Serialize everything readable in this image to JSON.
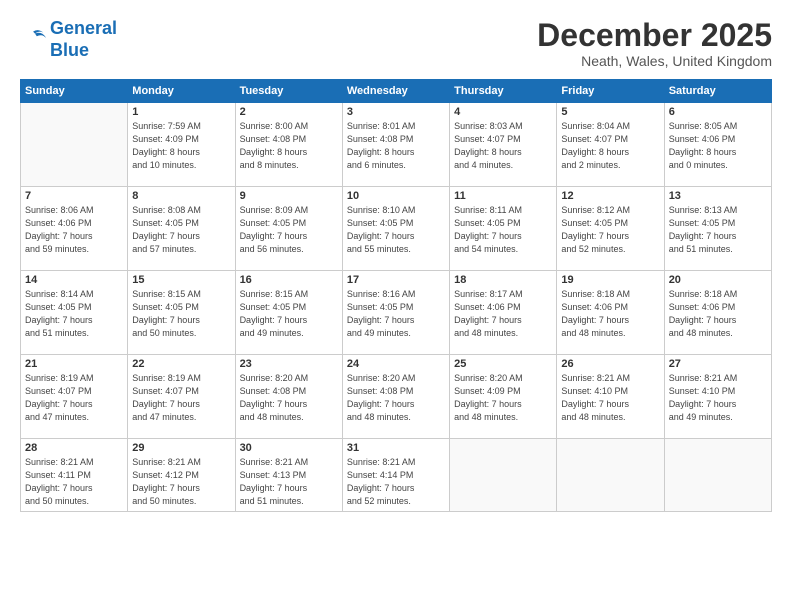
{
  "header": {
    "logo_line1": "General",
    "logo_line2": "Blue",
    "month_title": "December 2025",
    "location": "Neath, Wales, United Kingdom"
  },
  "weekdays": [
    "Sunday",
    "Monday",
    "Tuesday",
    "Wednesday",
    "Thursday",
    "Friday",
    "Saturday"
  ],
  "weeks": [
    [
      {
        "day": "",
        "info": ""
      },
      {
        "day": "1",
        "info": "Sunrise: 7:59 AM\nSunset: 4:09 PM\nDaylight: 8 hours\nand 10 minutes."
      },
      {
        "day": "2",
        "info": "Sunrise: 8:00 AM\nSunset: 4:08 PM\nDaylight: 8 hours\nand 8 minutes."
      },
      {
        "day": "3",
        "info": "Sunrise: 8:01 AM\nSunset: 4:08 PM\nDaylight: 8 hours\nand 6 minutes."
      },
      {
        "day": "4",
        "info": "Sunrise: 8:03 AM\nSunset: 4:07 PM\nDaylight: 8 hours\nand 4 minutes."
      },
      {
        "day": "5",
        "info": "Sunrise: 8:04 AM\nSunset: 4:07 PM\nDaylight: 8 hours\nand 2 minutes."
      },
      {
        "day": "6",
        "info": "Sunrise: 8:05 AM\nSunset: 4:06 PM\nDaylight: 8 hours\nand 0 minutes."
      }
    ],
    [
      {
        "day": "7",
        "info": "Sunrise: 8:06 AM\nSunset: 4:06 PM\nDaylight: 7 hours\nand 59 minutes."
      },
      {
        "day": "8",
        "info": "Sunrise: 8:08 AM\nSunset: 4:05 PM\nDaylight: 7 hours\nand 57 minutes."
      },
      {
        "day": "9",
        "info": "Sunrise: 8:09 AM\nSunset: 4:05 PM\nDaylight: 7 hours\nand 56 minutes."
      },
      {
        "day": "10",
        "info": "Sunrise: 8:10 AM\nSunset: 4:05 PM\nDaylight: 7 hours\nand 55 minutes."
      },
      {
        "day": "11",
        "info": "Sunrise: 8:11 AM\nSunset: 4:05 PM\nDaylight: 7 hours\nand 54 minutes."
      },
      {
        "day": "12",
        "info": "Sunrise: 8:12 AM\nSunset: 4:05 PM\nDaylight: 7 hours\nand 52 minutes."
      },
      {
        "day": "13",
        "info": "Sunrise: 8:13 AM\nSunset: 4:05 PM\nDaylight: 7 hours\nand 51 minutes."
      }
    ],
    [
      {
        "day": "14",
        "info": "Sunrise: 8:14 AM\nSunset: 4:05 PM\nDaylight: 7 hours\nand 51 minutes."
      },
      {
        "day": "15",
        "info": "Sunrise: 8:15 AM\nSunset: 4:05 PM\nDaylight: 7 hours\nand 50 minutes."
      },
      {
        "day": "16",
        "info": "Sunrise: 8:15 AM\nSunset: 4:05 PM\nDaylight: 7 hours\nand 49 minutes."
      },
      {
        "day": "17",
        "info": "Sunrise: 8:16 AM\nSunset: 4:05 PM\nDaylight: 7 hours\nand 49 minutes."
      },
      {
        "day": "18",
        "info": "Sunrise: 8:17 AM\nSunset: 4:06 PM\nDaylight: 7 hours\nand 48 minutes."
      },
      {
        "day": "19",
        "info": "Sunrise: 8:18 AM\nSunset: 4:06 PM\nDaylight: 7 hours\nand 48 minutes."
      },
      {
        "day": "20",
        "info": "Sunrise: 8:18 AM\nSunset: 4:06 PM\nDaylight: 7 hours\nand 48 minutes."
      }
    ],
    [
      {
        "day": "21",
        "info": "Sunrise: 8:19 AM\nSunset: 4:07 PM\nDaylight: 7 hours\nand 47 minutes."
      },
      {
        "day": "22",
        "info": "Sunrise: 8:19 AM\nSunset: 4:07 PM\nDaylight: 7 hours\nand 47 minutes."
      },
      {
        "day": "23",
        "info": "Sunrise: 8:20 AM\nSunset: 4:08 PM\nDaylight: 7 hours\nand 48 minutes."
      },
      {
        "day": "24",
        "info": "Sunrise: 8:20 AM\nSunset: 4:08 PM\nDaylight: 7 hours\nand 48 minutes."
      },
      {
        "day": "25",
        "info": "Sunrise: 8:20 AM\nSunset: 4:09 PM\nDaylight: 7 hours\nand 48 minutes."
      },
      {
        "day": "26",
        "info": "Sunrise: 8:21 AM\nSunset: 4:10 PM\nDaylight: 7 hours\nand 48 minutes."
      },
      {
        "day": "27",
        "info": "Sunrise: 8:21 AM\nSunset: 4:10 PM\nDaylight: 7 hours\nand 49 minutes."
      }
    ],
    [
      {
        "day": "28",
        "info": "Sunrise: 8:21 AM\nSunset: 4:11 PM\nDaylight: 7 hours\nand 50 minutes."
      },
      {
        "day": "29",
        "info": "Sunrise: 8:21 AM\nSunset: 4:12 PM\nDaylight: 7 hours\nand 50 minutes."
      },
      {
        "day": "30",
        "info": "Sunrise: 8:21 AM\nSunset: 4:13 PM\nDaylight: 7 hours\nand 51 minutes."
      },
      {
        "day": "31",
        "info": "Sunrise: 8:21 AM\nSunset: 4:14 PM\nDaylight: 7 hours\nand 52 minutes."
      },
      {
        "day": "",
        "info": ""
      },
      {
        "day": "",
        "info": ""
      },
      {
        "day": "",
        "info": ""
      }
    ]
  ]
}
